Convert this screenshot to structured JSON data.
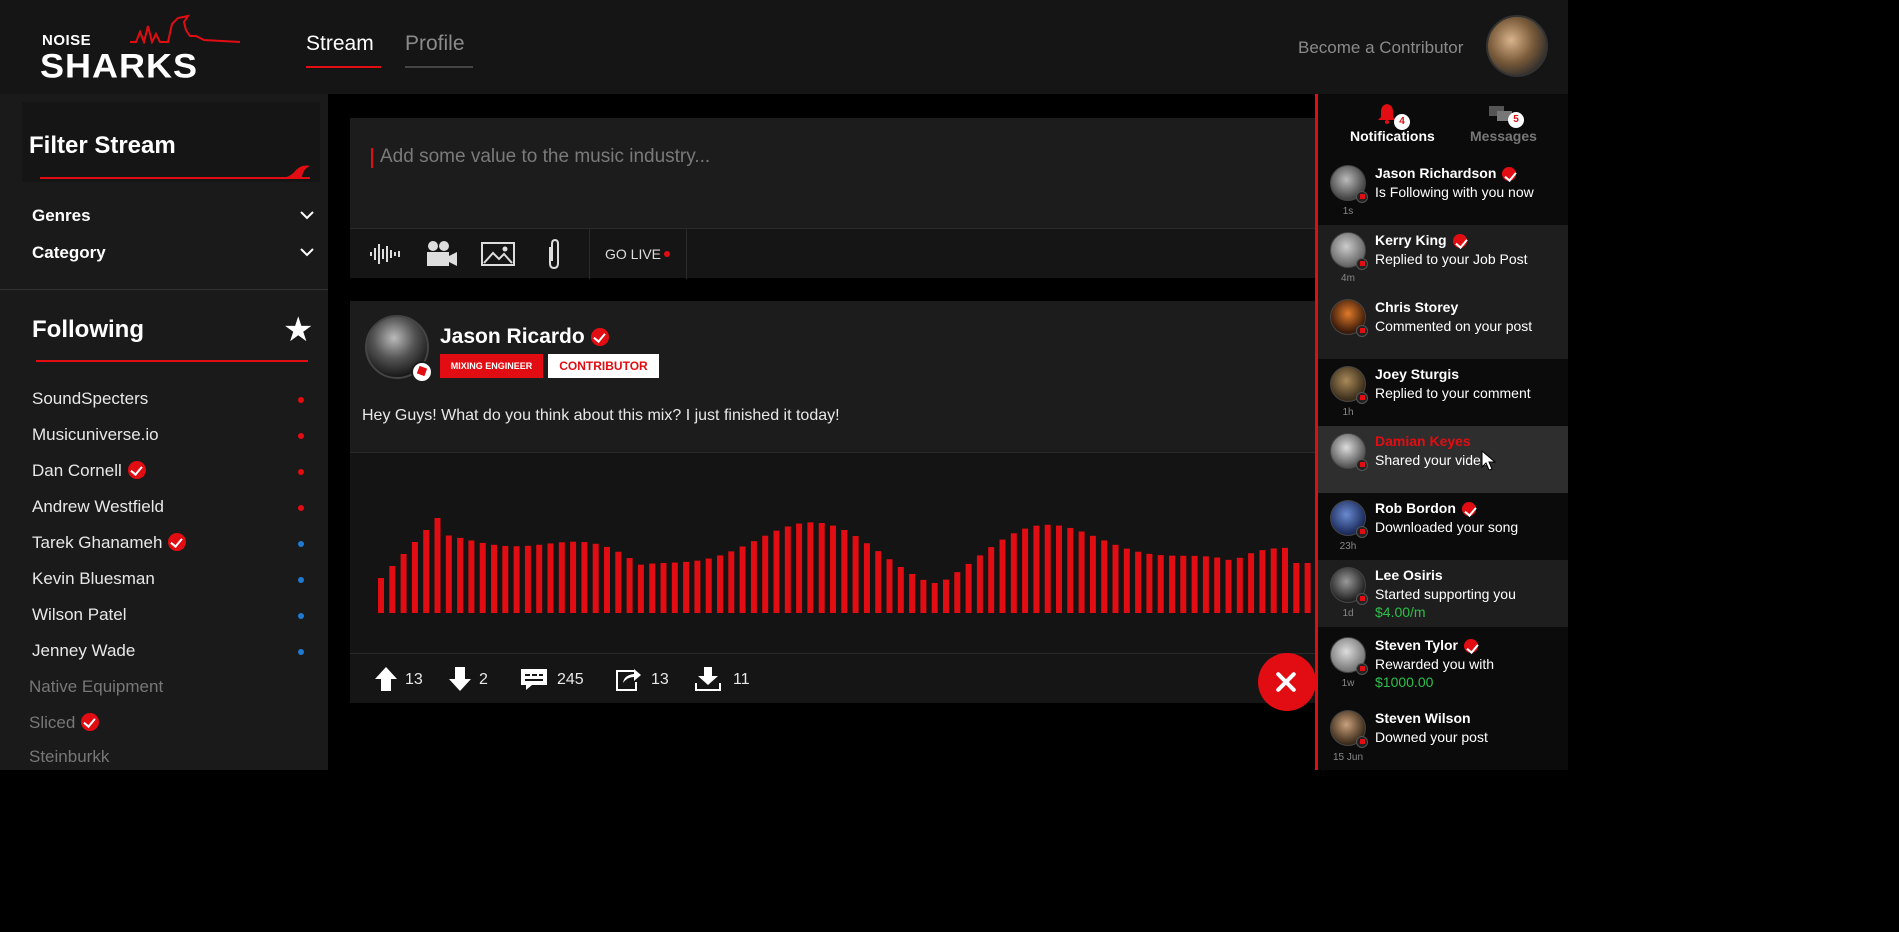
{
  "brand": {
    "top": "NOISE",
    "bottom": "SHARKS"
  },
  "nav": {
    "stream": "Stream",
    "profile": "Profile",
    "contributor_link": "Become a Contributor"
  },
  "sidebar": {
    "filter_title": "Filter Stream",
    "genres": "Genres",
    "category": "Category",
    "following_title": "Following",
    "following": [
      {
        "name": "SoundSpecters",
        "verified": false,
        "status": "red"
      },
      {
        "name": "Musicuniverse.io",
        "verified": false,
        "status": "red"
      },
      {
        "name": "Dan Cornell",
        "verified": true,
        "status": "red"
      },
      {
        "name": "Andrew Westfield",
        "verified": false,
        "status": "red"
      },
      {
        "name": "Tarek Ghanameh",
        "verified": true,
        "status": "blue"
      },
      {
        "name": "Kevin Bluesman",
        "verified": false,
        "status": "blue"
      },
      {
        "name": "Wilson Patel",
        "verified": false,
        "status": "blue"
      },
      {
        "name": "Jenney Wade",
        "verified": false,
        "status": "blue"
      },
      {
        "name": "Native Equipment",
        "verified": false,
        "status": "none"
      },
      {
        "name": "Sliced",
        "verified": true,
        "status": "none"
      },
      {
        "name": "Steinburkk",
        "verified": false,
        "status": "none"
      }
    ]
  },
  "composer": {
    "placeholder": "Add some value to the music industry...",
    "go_live": "GO LIVE",
    "tools": [
      "waveform-icon",
      "video-camera-icon",
      "image-icon",
      "paperclip-icon"
    ]
  },
  "post": {
    "author": "Jason Ricardo",
    "badges": [
      "MIXING ENGINEER",
      "CONTRIBUTOR"
    ],
    "text": "Hey Guys! What do you think about this mix? I just finished it today!",
    "upvotes": "13",
    "downvotes": "2",
    "comments": "245",
    "shares": "13",
    "downloads": "11"
  },
  "notifications": {
    "tab_notifications": "Notifications",
    "tab_messages": "Messages",
    "notif_count": "4",
    "msg_count": "5",
    "items": [
      {
        "name": "Jason Richardson",
        "verified": true,
        "action": "Is Following with you now",
        "time": "1s"
      },
      {
        "name": "Kerry King",
        "verified": true,
        "action": "Replied to your Job Post",
        "time": "4m"
      },
      {
        "name": "Chris Storey",
        "verified": false,
        "action": "Commented on your post",
        "time": ""
      },
      {
        "name": "Joey Sturgis",
        "verified": false,
        "action": "Replied to your comment",
        "time": "1h"
      },
      {
        "name": "Damian Keyes",
        "verified": false,
        "action": "Shared your video",
        "time": ""
      },
      {
        "name": "Rob Bordon",
        "verified": true,
        "action": "Downloaded your song",
        "time": "23h"
      },
      {
        "name": "Lee Osiris",
        "verified": false,
        "action": "Started supporting you",
        "amount": "$4.00/m",
        "time": "1d"
      },
      {
        "name": "Steven Tylor",
        "verified": true,
        "action": "Rewarded you with",
        "amount": "$1000.00",
        "time": "1w"
      },
      {
        "name": "Steven Wilson",
        "verified": false,
        "action": "Downed your post",
        "time": "15 Jun"
      }
    ]
  },
  "colors": {
    "accent": "#e10d12",
    "online_blue": "#1f7ad0",
    "green": "#2ebf4a"
  }
}
